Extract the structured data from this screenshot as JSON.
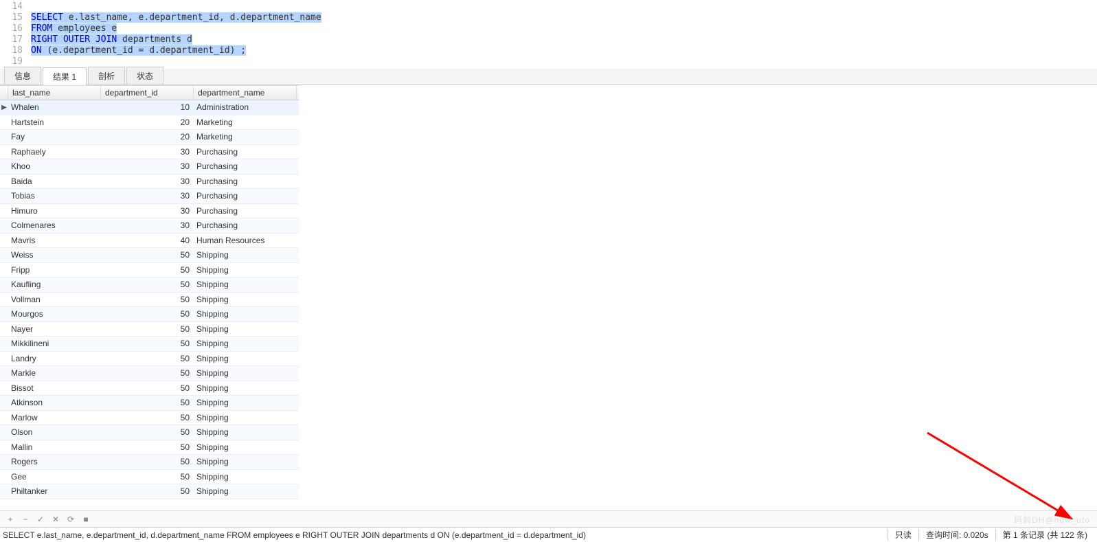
{
  "editor": {
    "lines": [
      {
        "num": "14",
        "tokens": []
      },
      {
        "num": "15",
        "tokens": [
          {
            "t": "SELECT",
            "c": "kw sel"
          },
          {
            "t": " e.last_name, e.department_id, d.department_name",
            "c": "sel"
          }
        ]
      },
      {
        "num": "16",
        "tokens": [
          {
            "t": "FROM",
            "c": "kw sel"
          },
          {
            "t": " employees e",
            "c": "sel"
          }
        ]
      },
      {
        "num": "17",
        "tokens": [
          {
            "t": "RIGHT OUTER JOIN",
            "c": "kw sel"
          },
          {
            "t": " departments d",
            "c": "sel"
          }
        ]
      },
      {
        "num": "18",
        "tokens": [
          {
            "t": "ON",
            "c": "kw sel"
          },
          {
            "t": " (e.department_id = d.department_id) ;",
            "c": "sel"
          }
        ]
      },
      {
        "num": "19",
        "tokens": []
      }
    ]
  },
  "tabs": {
    "items": [
      {
        "label": "信息",
        "active": false
      },
      {
        "label": "结果 1",
        "active": true
      },
      {
        "label": "剖析",
        "active": false
      },
      {
        "label": "状态",
        "active": false
      }
    ]
  },
  "grid": {
    "columns": [
      "last_name",
      "department_id",
      "department_name"
    ],
    "rows": [
      {
        "last_name": "Whalen",
        "department_id": "10",
        "department_name": "Administration",
        "current": true
      },
      {
        "last_name": "Hartstein",
        "department_id": "20",
        "department_name": "Marketing"
      },
      {
        "last_name": "Fay",
        "department_id": "20",
        "department_name": "Marketing"
      },
      {
        "last_name": "Raphaely",
        "department_id": "30",
        "department_name": "Purchasing"
      },
      {
        "last_name": "Khoo",
        "department_id": "30",
        "department_name": "Purchasing"
      },
      {
        "last_name": "Baida",
        "department_id": "30",
        "department_name": "Purchasing"
      },
      {
        "last_name": "Tobias",
        "department_id": "30",
        "department_name": "Purchasing"
      },
      {
        "last_name": "Himuro",
        "department_id": "30",
        "department_name": "Purchasing"
      },
      {
        "last_name": "Colmenares",
        "department_id": "30",
        "department_name": "Purchasing"
      },
      {
        "last_name": "Mavris",
        "department_id": "40",
        "department_name": "Human Resources"
      },
      {
        "last_name": "Weiss",
        "department_id": "50",
        "department_name": "Shipping"
      },
      {
        "last_name": "Fripp",
        "department_id": "50",
        "department_name": "Shipping"
      },
      {
        "last_name": "Kaufling",
        "department_id": "50",
        "department_name": "Shipping"
      },
      {
        "last_name": "Vollman",
        "department_id": "50",
        "department_name": "Shipping"
      },
      {
        "last_name": "Mourgos",
        "department_id": "50",
        "department_name": "Shipping"
      },
      {
        "last_name": "Nayer",
        "department_id": "50",
        "department_name": "Shipping"
      },
      {
        "last_name": "Mikkilineni",
        "department_id": "50",
        "department_name": "Shipping"
      },
      {
        "last_name": "Landry",
        "department_id": "50",
        "department_name": "Shipping"
      },
      {
        "last_name": "Markle",
        "department_id": "50",
        "department_name": "Shipping"
      },
      {
        "last_name": "Bissot",
        "department_id": "50",
        "department_name": "Shipping"
      },
      {
        "last_name": "Atkinson",
        "department_id": "50",
        "department_name": "Shipping"
      },
      {
        "last_name": "Marlow",
        "department_id": "50",
        "department_name": "Shipping"
      },
      {
        "last_name": "Olson",
        "department_id": "50",
        "department_name": "Shipping"
      },
      {
        "last_name": "Mallin",
        "department_id": "50",
        "department_name": "Shipping"
      },
      {
        "last_name": "Rogers",
        "department_id": "50",
        "department_name": "Shipping"
      },
      {
        "last_name": "Gee",
        "department_id": "50",
        "department_name": "Shipping"
      },
      {
        "last_name": "Philtanker",
        "department_id": "50",
        "department_name": "Shipping"
      }
    ]
  },
  "toolbar": {
    "add": "+",
    "remove": "−",
    "apply": "✓",
    "cancel": "✕",
    "refresh": "⟳",
    "stop": "■"
  },
  "statusbar": {
    "sql": "SELECT e.last_name, e.department_id, d.department_name FROM employees e RIGHT OUTER JOIN departments d ON (e.department_id = d.department_id)",
    "readonly": "只读",
    "time": "查询时间: 0.020s",
    "records": "第 1 条记录 (共 122 条)"
  },
  "watermark": "码龄DH@now_ufo"
}
